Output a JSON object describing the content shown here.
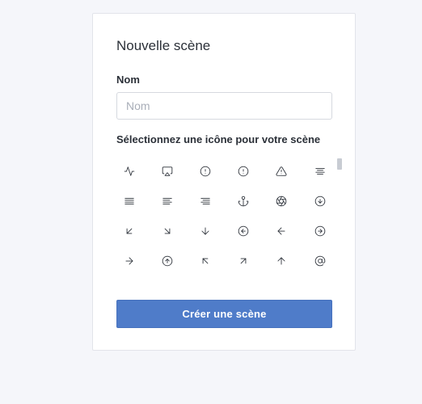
{
  "dialog": {
    "title": "Nouvelle scène",
    "name_label": "Nom",
    "name_placeholder": "Nom",
    "name_value": "",
    "icon_label": "Sélectionnez une icône pour votre scène",
    "icons": [
      "activity-icon",
      "airplay-icon",
      "alert-circle-icon",
      "alert-octagon-icon",
      "alert-triangle-icon",
      "align-center-icon",
      "align-justify-icon",
      "align-left-icon",
      "align-right-icon",
      "anchor-icon",
      "aperture-icon",
      "arrow-down-circle-icon",
      "arrow-down-left-icon",
      "arrow-down-right-icon",
      "arrow-down-icon",
      "arrow-left-circle-icon",
      "arrow-left-icon",
      "arrow-right-circle-icon",
      "arrow-right-icon",
      "arrow-up-circle-icon",
      "arrow-up-left-icon",
      "arrow-up-right-icon",
      "arrow-up-icon",
      "at-sign-icon"
    ],
    "create_button_label": "Créer une scène"
  },
  "colors": {
    "page_background": "#f5f6fa",
    "card_background": "#ffffff",
    "button_background": "#4f7cc9",
    "button_text": "#ffffff",
    "text": "#2b3038",
    "placeholder": "#a9aeb8"
  }
}
